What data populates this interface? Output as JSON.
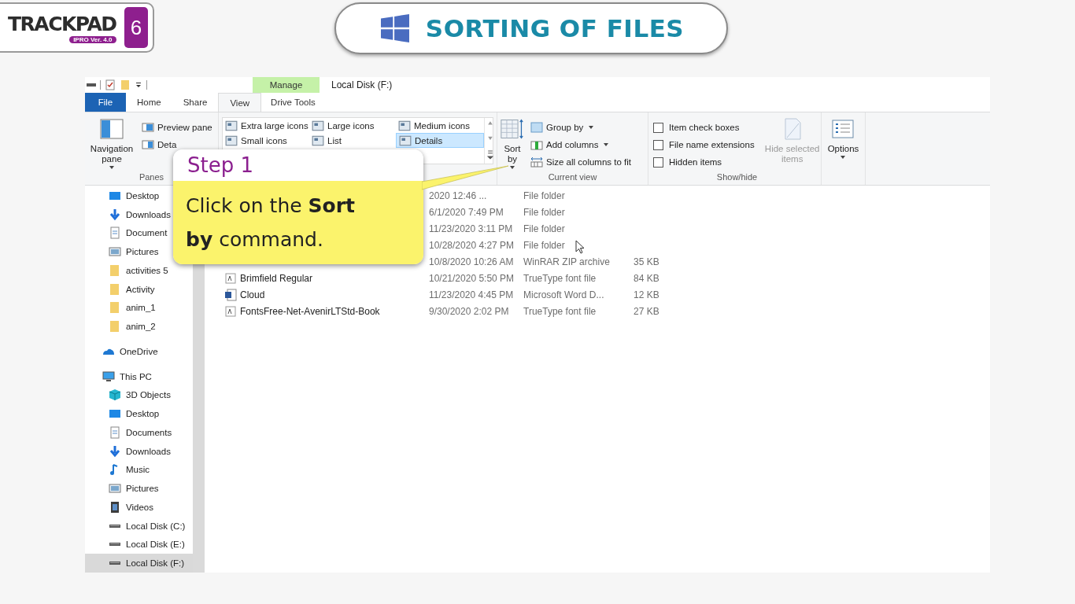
{
  "brand": {
    "name": "TRACKPAD",
    "edition": "6",
    "version": "IPRO Ver. 4.0"
  },
  "lesson_title": "SORTING OF FILES",
  "explorer": {
    "window_title": "Local Disk (F:)",
    "context_tab": "Manage",
    "tabs": [
      {
        "label": "File",
        "kind": "file",
        "selected": false
      },
      {
        "label": "Home",
        "kind": "tab",
        "selected": false
      },
      {
        "label": "Share",
        "kind": "tab",
        "selected": false
      },
      {
        "label": "View",
        "kind": "tab",
        "selected": true
      },
      {
        "label": "Drive Tools",
        "kind": "context",
        "selected": false
      }
    ],
    "ribbon": {
      "panes": {
        "label": "Panes",
        "navigation_pane": "Navigation pane",
        "preview_pane": "Preview pane",
        "details_pane": "Deta"
      },
      "layout": [
        {
          "label": "Extra large icons",
          "selected": false
        },
        {
          "label": "Large icons",
          "selected": false
        },
        {
          "label": "Medium icons",
          "selected": false
        },
        {
          "label": "Small icons",
          "selected": false
        },
        {
          "label": "List",
          "selected": false
        },
        {
          "label": "Details",
          "selected": true
        }
      ],
      "current_view": {
        "label": "Current view",
        "sort_by": "Sort by",
        "group_by": "Group by",
        "add_columns": "Add columns",
        "size_columns": "Size all columns to fit"
      },
      "show_hide": {
        "label": "Show/hide",
        "checkboxes": [
          {
            "label": "Item check boxes",
            "checked": false
          },
          {
            "label": "File name extensions",
            "checked": false
          },
          {
            "label": "Hidden items",
            "checked": false
          }
        ],
        "hide_selected": {
          "label": "Hide selected items",
          "disabled": true
        }
      },
      "options": {
        "label": "Options"
      }
    },
    "navigation_pane": {
      "quick_access": [
        {
          "label": "Desktop",
          "kind": "desktop",
          "selected": false
        },
        {
          "label": "Downloads",
          "kind": "download",
          "selected": false
        },
        {
          "label": "Document",
          "kind": "document",
          "selected": false
        },
        {
          "label": "Pictures",
          "kind": "pictures",
          "selected": false
        },
        {
          "label": "activities 5",
          "kind": "folder",
          "selected": false
        },
        {
          "label": "Activity",
          "kind": "folder",
          "selected": false
        },
        {
          "label": "anim_1",
          "kind": "folder",
          "selected": false
        },
        {
          "label": "anim_2",
          "kind": "folder",
          "selected": false
        }
      ],
      "tree": [
        {
          "label": "OneDrive",
          "kind": "cloud",
          "selected": false
        },
        {
          "label": "This PC",
          "kind": "pc",
          "selected": false,
          "children": [
            {
              "label": "3D Objects",
              "kind": "cube",
              "selected": false
            },
            {
              "label": "Desktop",
              "kind": "desktop",
              "selected": false
            },
            {
              "label": "Documents",
              "kind": "document",
              "selected": false
            },
            {
              "label": "Downloads",
              "kind": "download",
              "selected": false
            },
            {
              "label": "Music",
              "kind": "music",
              "selected": false
            },
            {
              "label": "Pictures",
              "kind": "pictures",
              "selected": false
            },
            {
              "label": "Videos",
              "kind": "video",
              "selected": false
            },
            {
              "label": "Local Disk (C:)",
              "kind": "disk",
              "selected": false
            },
            {
              "label": "Local Disk (E:)",
              "kind": "disk",
              "selected": false
            },
            {
              "label": "Local Disk (F:)",
              "kind": "disk",
              "selected": true
            }
          ]
        }
      ]
    },
    "files": [
      {
        "kind": "folder",
        "date": "2020 12:46 ...",
        "type": "File folder"
      },
      {
        "kind": "folder",
        "date": "6/1/2020 7:49 PM",
        "type": "File folder"
      },
      {
        "kind": "folder",
        "date": "11/23/2020 3:11 PM",
        "type": "File folder"
      },
      {
        "kind": "folder",
        "date": "10/28/2020 4:27 PM",
        "type": "File folder"
      },
      {
        "kind": "zip",
        "date": "10/8/2020 10:26 AM",
        "type": "WinRAR ZIP archive",
        "size": "35 KB"
      },
      {
        "kind": "font",
        "name": "Brimfield Regular",
        "date": "10/21/2020 5:50 PM",
        "type": "TrueType font file",
        "size": "84 KB"
      },
      {
        "kind": "word",
        "name": "Cloud",
        "date": "11/23/2020 4:45 PM",
        "type": "Microsoft Word D...",
        "size": "12 KB"
      },
      {
        "kind": "font",
        "name": "FontsFree-Net-AvenirLTStd-Book",
        "date": "9/30/2020 2:02 PM",
        "type": "TrueType font file",
        "size": "27 KB"
      }
    ]
  },
  "callout": {
    "title": "Step 1",
    "text": "Click on the **Sort by** command."
  }
}
